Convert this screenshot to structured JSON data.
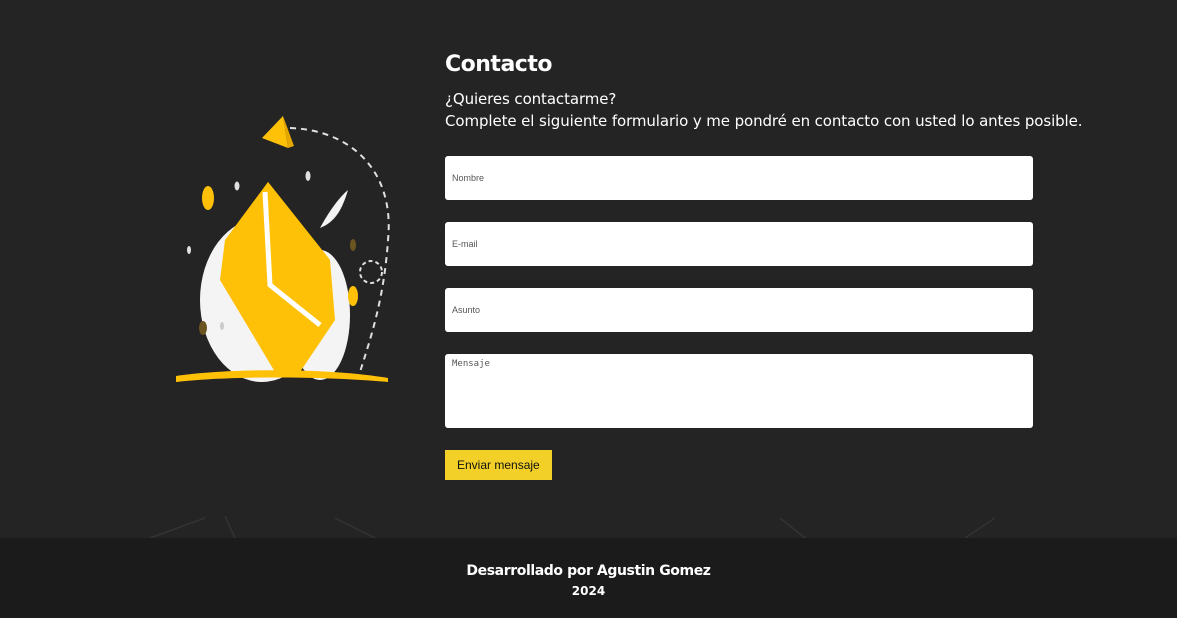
{
  "contact": {
    "title": "Contacto",
    "intro_line1": "¿Quieres contactarme?",
    "intro_line2": "Complete el siguiente formulario y me pondré en contacto con usted lo antes posible."
  },
  "form": {
    "name_placeholder": "Nombre",
    "email_placeholder": "E-mail",
    "subject_placeholder": "Asunto",
    "message_placeholder": "Mensaje",
    "submit_label": "Enviar mensaje"
  },
  "footer": {
    "credit": "Desarrollado por Agustin Gomez",
    "year": "2024"
  },
  "colors": {
    "background": "#242424",
    "footer": "#1b1b1b",
    "accent": "#f2d027",
    "illustration_yellow": "#ffc107"
  },
  "icons": {
    "illustration": "paper-plane-envelope-illustration"
  }
}
